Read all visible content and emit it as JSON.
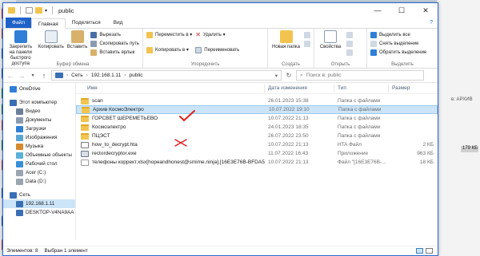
{
  "window": {
    "title": "public",
    "controls": {
      "minimize": "—",
      "maximize": "☐",
      "close": "✕"
    }
  },
  "tabs": [
    "Файл",
    "Главная",
    "Поделиться",
    "Вид"
  ],
  "ribbon": {
    "clipboard": {
      "pin": "Закрепить на панели быстрого доступа",
      "copy": "Копировать",
      "paste": "Вставить",
      "cut": "Вырезать",
      "copy_path": "Скопировать путь",
      "paste_shortcut": "Вставить ярлык",
      "title": "Буфер обмена"
    },
    "organize": {
      "move_to": "Переместить в ▾",
      "copy_to": "Копировать в ▾",
      "delete": "Удалить ▾",
      "rename": "Переименовать",
      "title": "Упорядочить"
    },
    "new": {
      "new_folder": "Новая папка",
      "title": "Создать"
    },
    "open": {
      "properties": "Свойства",
      "title": "Открыть"
    },
    "select": {
      "select_all": "Выделить все",
      "select_none": "Снять выделение",
      "invert": "Обратить выделение",
      "title": "Выделить"
    }
  },
  "address": {
    "crumbs": [
      "Сеть",
      "192.168.1.11",
      "public"
    ],
    "search_placeholder": "Поиск в: public"
  },
  "sidebar": [
    {
      "label": "OneDrive",
      "level": 0,
      "color": "#2f7fd6"
    },
    {
      "label": "Этот компьютер",
      "level": 0,
      "color": "#3a6fb5"
    },
    {
      "label": "Видео",
      "level": 1,
      "color": "#6b7f99"
    },
    {
      "label": "Документы",
      "level": 1,
      "color": "#8a9bb0"
    },
    {
      "label": "Загрузки",
      "level": 1,
      "color": "#2f7fd6"
    },
    {
      "label": "Изображения",
      "level": 1,
      "color": "#58a6d6"
    },
    {
      "label": "Музыка",
      "level": 1,
      "color": "#d68a2f"
    },
    {
      "label": "Объемные объекты",
      "level": 1,
      "color": "#5ab0d8"
    },
    {
      "label": "Рабочий стол",
      "level": 1,
      "color": "#3a8fd6"
    },
    {
      "label": "Acer (C:)",
      "level": 1,
      "color": "#9aa5b1"
    },
    {
      "label": "Data (D:)",
      "level": 1,
      "color": "#9aa5b1"
    },
    {
      "label": "Сеть",
      "level": 0,
      "color": "#3a6fb5"
    },
    {
      "label": "192.168.1.11",
      "level": 1,
      "color": "#3a6fb5"
    },
    {
      "label": "DESKTOP-V4NA9AA",
      "level": 1,
      "color": "#3a6fb5"
    }
  ],
  "columns": {
    "name": "Имя",
    "date": "Дата изменения",
    "type": "Тип",
    "size": "Размер"
  },
  "files": [
    {
      "name": "scan",
      "date": "26.01.2023 15:38",
      "type": "Папка с файлами",
      "size": "",
      "icon": "folder"
    },
    {
      "name": "Архив КосмоЭлектро",
      "date": "10.07.2022 19:10",
      "type": "Папка с файлами",
      "size": "",
      "icon": "folder"
    },
    {
      "name": "ГОРСВЕТ ШЕРЕМЕТЬЕВО",
      "date": "10.07.2022 21:13",
      "type": "Папка с файлами",
      "size": "",
      "icon": "folder"
    },
    {
      "name": "Космоэлектро",
      "date": "24.01.2023 18:35",
      "type": "Папка с файлами",
      "size": "",
      "icon": "folder"
    },
    {
      "name": "ПЦЭСТ",
      "date": "26.07.2022 23:50",
      "type": "Папка с файлами",
      "size": "",
      "icon": "folder"
    },
    {
      "name": "how_to_decrypt.hta",
      "date": "10.07.2022 21:13",
      "type": "HTA Файл",
      "size": "2 КБ",
      "icon": "html"
    },
    {
      "name": "rectordecryptor.exe",
      "date": "11.07.2022 16:43",
      "type": "Приложение",
      "size": "963 КБ",
      "icon": "exe"
    },
    {
      "name": "телефоны коррект.xlsx[hopeandhonest@smime.ninja].[16E3E76B-BFDA5A03]",
      "date": "10.07.2022 21:13",
      "type": "Файл \"[16E3E76B-...",
      "size": "18 КБ",
      "icon": "doc"
    }
  ],
  "status": {
    "count": "Элементов: 8",
    "selected": "Выбран 1 элемент"
  },
  "desktop_right": {
    "label": "в: АРХИВ",
    "value": "179 КБ"
  }
}
